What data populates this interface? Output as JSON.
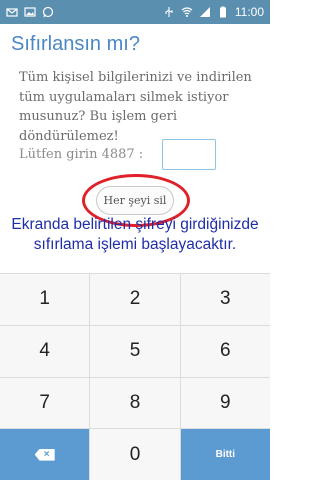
{
  "status_bar": {
    "time": "11:00",
    "left_icons": [
      "mail-icon",
      "image-icon",
      "whatsapp-icon"
    ],
    "right_icons": [
      "usb-icon",
      "wifi-icon",
      "signal-icon",
      "battery-icon"
    ]
  },
  "dialog": {
    "title": "Sıfırlansın mı?",
    "message": "Tüm kişisel bilgilerinizi ve indirilen tüm uygulamaları silmek istiyor musunuz? Bu işlem geri döndürülemez!",
    "prompt_label": "Lütfen girin 4887 :",
    "input_value": "",
    "erase_button_label": "Her şeyi sil"
  },
  "annotation": {
    "line1": "Ekranda belirtilen şifreyi girdiğinizde",
    "line2": "sıfırlama işlemi başlayacaktır."
  },
  "keypad": {
    "keys": [
      "1",
      "2",
      "3",
      "4",
      "5",
      "6",
      "7",
      "8",
      "9"
    ],
    "zero": "0",
    "done_label": "Bitti"
  },
  "colors": {
    "status_bar": "#5a8fb0",
    "title": "#4a87c6",
    "highlight": "#e0202a",
    "annotation": "#1f2ea8",
    "action_keys": "#5b9bd1"
  }
}
